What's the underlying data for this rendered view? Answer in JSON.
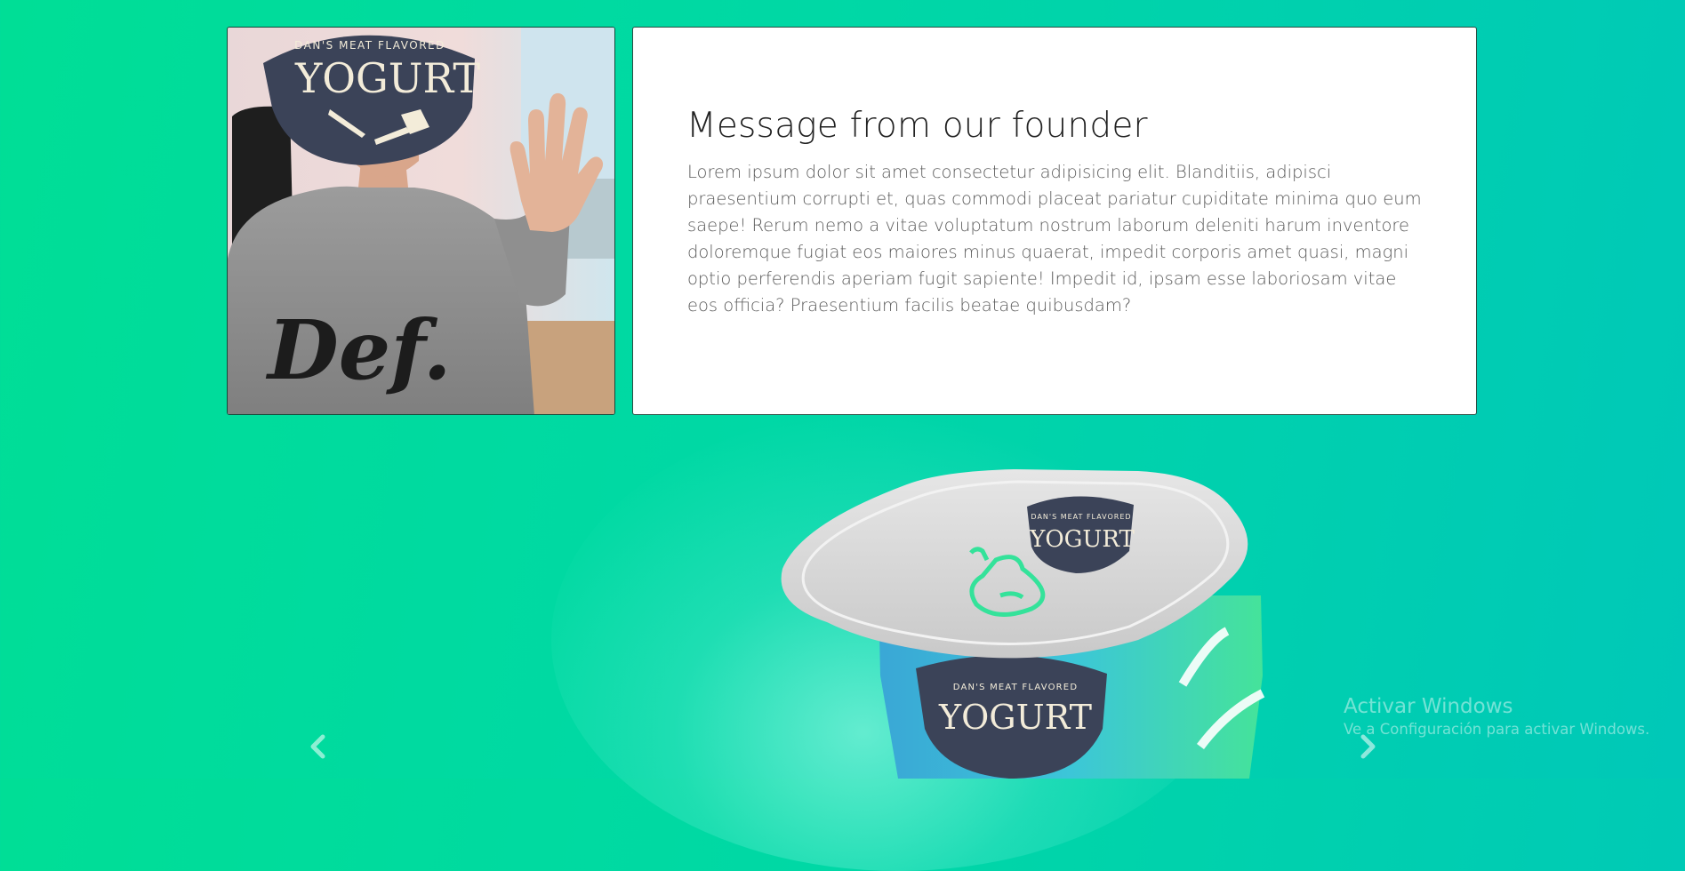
{
  "founder": {
    "title": "Message from our founder",
    "body": "Lorem ipsum dolor sit amet consectetur adipisicing elit. Blanditiis, adipisci praesentium corrupti et, quas commodi placeat pariatur cupiditate minima quo eum saepe! Rerum nemo a vitae voluptatum nostrum laborum deleniti harum inventore doloremque fugiat eos maiores minus quaerat, impedit corporis amet quasi, magni optio perferendis aperiam fugit sapiente! Impedit id, ipsam esse laboriosam vitae eos officia? Praesentium facilis beatae quibusdam?",
    "logo_tagline": "DAN'S MEAT FLAVORED",
    "logo_word": "YOGURT",
    "shirt_text": "Def."
  },
  "product": {
    "logo_tagline": "DAN'S MEAT FLAVORED",
    "logo_word": "YOGURT"
  },
  "carousel": {
    "prev_icon": "chevron-left-icon",
    "next_icon": "chevron-right-icon"
  },
  "watermark": {
    "title": "Activar Windows",
    "subtitle": "Ve a Configuración para activar Windows."
  },
  "colors": {
    "background_start": "#00de96",
    "background_end": "#00c8b8",
    "logo_navy": "#3b4358",
    "logo_cream": "#f3ecd9",
    "lid_green": "#34e29a"
  }
}
